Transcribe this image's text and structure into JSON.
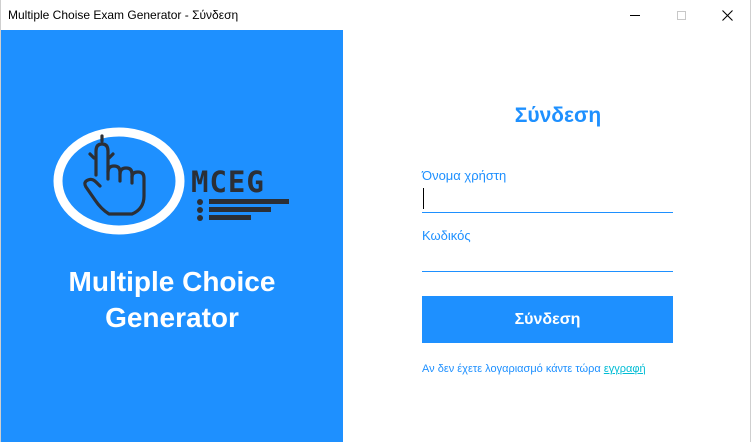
{
  "window": {
    "title": "Multiple Choise Exam Generator - Σύνδεση"
  },
  "brand": {
    "logo_text": "MCEG",
    "title_line1": "Multiple Choice",
    "title_line2": "Generator",
    "logo_icon": "pointing-hand-icon"
  },
  "login": {
    "heading": "Σύνδεση",
    "username_label": "Όνομα χρήστη",
    "username_value": "",
    "password_label": "Κωδικός",
    "password_value": "",
    "submit_label": "Σύνδεση",
    "register_prompt": "Αν δεν έχετε λογαριασμό κάντε τώρα",
    "register_link": "εγγραφή"
  },
  "colors": {
    "accent": "#1e90ff",
    "link": "#00bcd4",
    "logo_dark": "#2b2f36",
    "panel_text": "#ffffff"
  }
}
